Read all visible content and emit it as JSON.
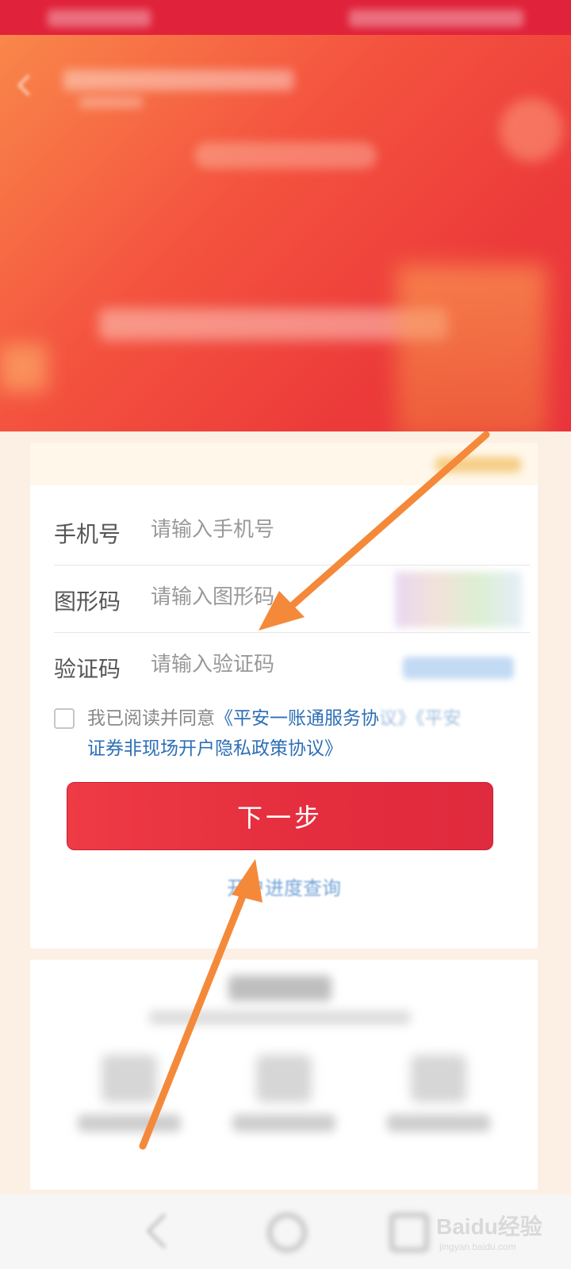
{
  "form": {
    "phone_label": "手机号",
    "phone_placeholder": "请输入手机号",
    "captcha_label": "图形码",
    "captcha_placeholder": "请输入图形码",
    "code_label": "验证码",
    "code_placeholder": "请输入验证码"
  },
  "agreement": {
    "prefix": "我已阅读并同意",
    "link1": "《平安一账通服务协",
    "link1_faded": "议》《平安",
    "link2": "证券非现场开户隐私政策协议》",
    "checked": false
  },
  "buttons": {
    "next": "下一步",
    "progress_link": "开户进度查询"
  },
  "watermark": {
    "brand": "Baidu经验",
    "domain": "jingyan.baidu.com"
  },
  "colors": {
    "brand_red": "#e0223a",
    "link_blue": "#2d6fb6",
    "annotation_arrow": "#f4893a"
  }
}
